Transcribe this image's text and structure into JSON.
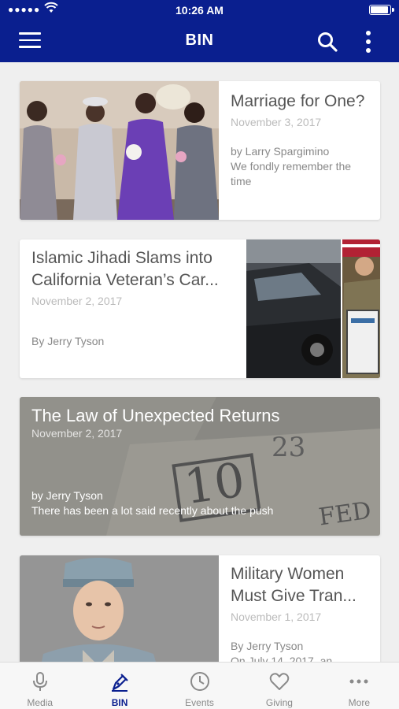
{
  "status_bar": {
    "signal": "●●●●●",
    "time": "10:26 AM"
  },
  "header": {
    "title": "BIN"
  },
  "colors": {
    "brand": "#0a1f8f",
    "tab_active": "#0a1f8f",
    "tab_inactive": "#8a8a8a"
  },
  "articles": [
    {
      "headline": "Marriage for One?",
      "date": "November 3, 2017",
      "byline": "by Larry Spargimino",
      "excerpt": "We fondly remember the time",
      "image": "wedding-party-photo"
    },
    {
      "headline": "Islamic Jihadi Slams into California Veteran’s Car...",
      "date": "November 2, 2017",
      "byline": "By Jerry Tyson",
      "excerpt": "",
      "image": "wrecked-car-and-soldier-photo"
    },
    {
      "headline": "The Law of Unexpected Returns",
      "date": "November 2, 2017",
      "byline": "by Jerry Tyson",
      "excerpt": "There has been a lot said recently about the push",
      "image": "ten-dollar-bill-photo"
    },
    {
      "headline": "Military Women Must Give Tran...",
      "date": "November 1, 2017",
      "byline": "By Jerry Tyson",
      "excerpt": "On July 14, 2017, an",
      "image": "female-soldier-photo"
    }
  ],
  "tabs": [
    {
      "label": "Media",
      "icon": "microphone-icon",
      "active": false
    },
    {
      "label": "BIN",
      "icon": "pen-icon",
      "active": true
    },
    {
      "label": "Events",
      "icon": "clock-icon",
      "active": false
    },
    {
      "label": "Giving",
      "icon": "heart-icon",
      "active": false
    },
    {
      "label": "More",
      "icon": "more-dots-icon",
      "active": false
    }
  ]
}
